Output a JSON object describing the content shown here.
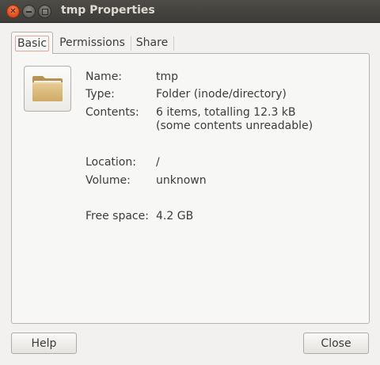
{
  "window": {
    "title": "tmp Properties"
  },
  "tabs": [
    {
      "label": "Basic"
    },
    {
      "label": "Permissions"
    },
    {
      "label": "Share"
    }
  ],
  "basic": {
    "icon": "folder-icon",
    "name_label": "Name:",
    "name_value": "tmp",
    "type_label": "Type:",
    "type_value": "Folder (inode/directory)",
    "contents_label": "Contents:",
    "contents_value_line1": "6 items, totalling 12.3 kB",
    "contents_value_line2": "(some contents unreadable)",
    "location_label": "Location:",
    "location_value": "/",
    "volume_label": "Volume:",
    "volume_value": "unknown",
    "free_space_label": "Free space:",
    "free_space_value": "4.2 GB"
  },
  "buttons": {
    "help_label": "Help",
    "close_label": "Close"
  },
  "colors": {
    "titlebar": "#3d3c38",
    "close_button": "#dd4814",
    "focus_ring": "#e9a593",
    "folder": "#d9b978"
  }
}
